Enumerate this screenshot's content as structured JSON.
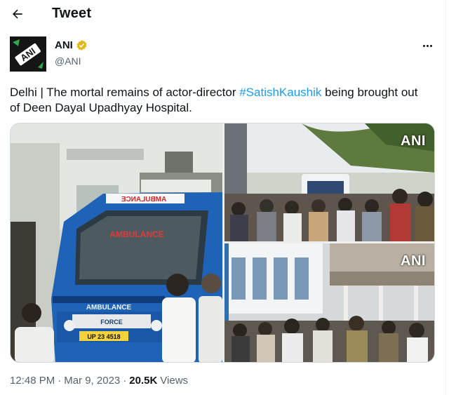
{
  "header": {
    "title": "Tweet"
  },
  "author": {
    "name": "ANI",
    "handle": "@ANI",
    "avatar_text": "ANI"
  },
  "tweet": {
    "text_before": "Delhi | The mortal remains of actor-director ",
    "hashtag": "#SatishKaushik",
    "text_after": " being brought out of Deen Dayal Upadhyay Hospital."
  },
  "media": {
    "photos": [
      {
        "watermark": ""
      },
      {
        "watermark": "ANI"
      },
      {
        "watermark": "ANI"
      }
    ],
    "ambulance": {
      "hood_text": "AMBULANCE",
      "windshield_text": "AMBULANCE",
      "plate": "UP 23 4518",
      "brand": "FORCE"
    }
  },
  "footer": {
    "time": "12:48 PM",
    "sep": "·",
    "date": "Mar 9, 2023",
    "sep2": "·",
    "views_count": "20.5K",
    "views_label": "Views"
  },
  "colors": {
    "accent": "#1d9bf0",
    "verified_badge": "#e2b719",
    "text": "#0f1419",
    "secondary": "#536471"
  },
  "icons": {
    "back": "arrow-left-icon",
    "verified": "verified-badge-icon",
    "more": "more-horizontal-icon"
  }
}
